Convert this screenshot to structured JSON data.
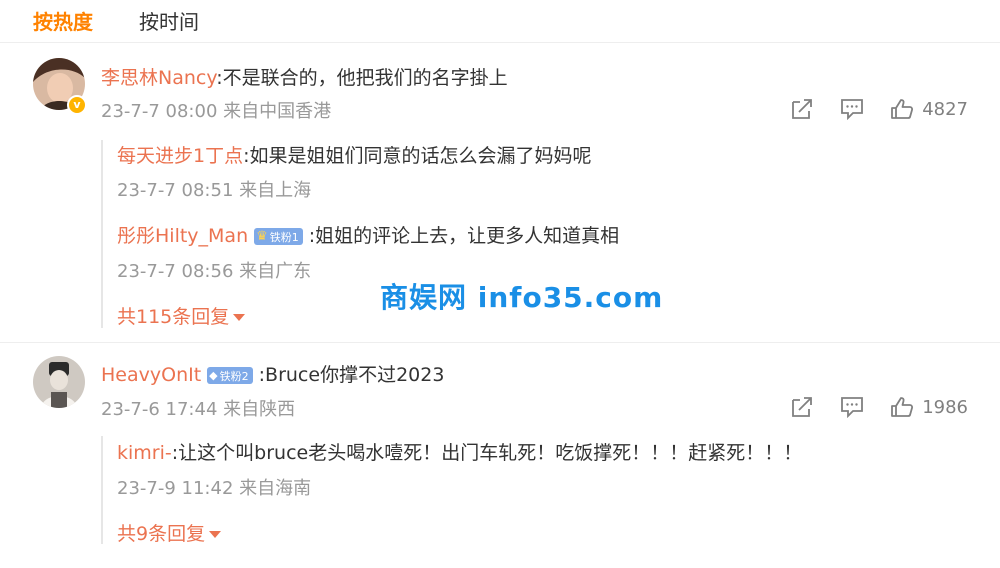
{
  "tabs": {
    "hot": "按热度",
    "time": "按时间"
  },
  "comments": [
    {
      "author": "李思林Nancy",
      "content": ":不是联合的，他把我们的名字掛上",
      "meta": "23-7-7 08:00 来自中国香港",
      "likes": "4827",
      "replies": [
        {
          "author": "每天进步1丁点",
          "content": ":如果是姐姐们同意的话怎么会漏了妈妈呢",
          "meta": "23-7-7 08:51 来自上海"
        },
        {
          "author": "彤彤Hilty_Man",
          "badge": "铁粉1",
          "content": ":姐姐的评论上去，让更多人知道真相",
          "meta": "23-7-7 08:56 来自广东"
        }
      ],
      "more": "共115条回复"
    },
    {
      "author": "HeavyOnIt",
      "badge": "铁粉2",
      "content": ":Bruce你撑不过2023",
      "meta": "23-7-6 17:44 来自陕西",
      "likes": "1986",
      "replies": [
        {
          "author": "kimri-",
          "content": ":让这个叫bruce老头喝水噎死！出门车轧死！吃饭撑死！！！赶紧死！！！",
          "meta": "23-7-9 11:42 来自海南"
        }
      ],
      "more": "共9条回复"
    }
  ],
  "watermark": "商娱网 info35.com",
  "icons": [
    "share-icon",
    "comment-icon",
    "like-icon",
    "verified-icon",
    "caret-down-icon"
  ]
}
